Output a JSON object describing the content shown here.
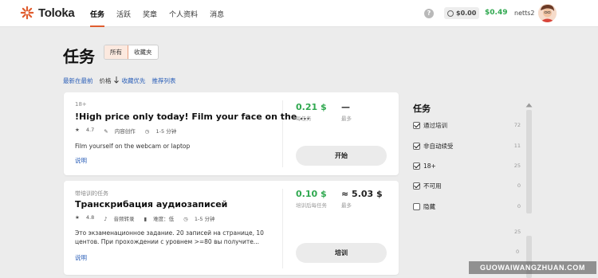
{
  "app": {
    "name": "Toloka"
  },
  "nav": {
    "items": [
      "任务",
      "活跃",
      "奖章",
      "个人资料",
      "消息"
    ]
  },
  "header": {
    "help": "?",
    "balance": "$0.00",
    "green_balance": "$0.49",
    "username": "netts2"
  },
  "page": {
    "title": "任务",
    "tabs": {
      "all": "所有",
      "favorites": "收藏夹"
    },
    "sort": {
      "newest": "最新在最前",
      "price": "价格",
      "favorites_first": "收藏优先",
      "recommended": "推荐列表"
    }
  },
  "cards": [
    {
      "eyebrow": "18+",
      "title": "!High price only today! Film your face on the ...",
      "meta": {
        "rating": "4.7",
        "tag": "内容创作",
        "time": "1-5 分钟"
      },
      "description": "Film yourself on the webcam or laptop",
      "link": "说明",
      "price": "0.21 $",
      "price_caption": "每任务",
      "max": "—",
      "max_caption": "最多",
      "button": "开始"
    },
    {
      "eyebrow": "带培训的任务",
      "title": "Транскрибация аудиозаписей",
      "meta": {
        "rating": "4.8",
        "tag": "音频转录",
        "difficulty": "难度：低",
        "time": "1-5 分钟"
      },
      "description": "Это экзаменационное задание. 20 записей на странице, 10 центов. При прохождении с уровнем >=80 вы получите...",
      "link": "说明",
      "price": "0.10 $",
      "price_caption": "培训后每任务",
      "max": "≈ 5.03 $",
      "max_caption": "最多",
      "button": "培训"
    }
  ],
  "filters": {
    "title": "任务",
    "items": [
      {
        "label": "通过培训",
        "count": "72",
        "checked": true
      },
      {
        "label": "非自动续受",
        "count": "11",
        "checked": true
      },
      {
        "label": "18+",
        "count": "25",
        "checked": true
      },
      {
        "label": "不可用",
        "count": "0",
        "checked": true
      },
      {
        "label": "隐藏",
        "count": "0",
        "checked": false
      }
    ],
    "stray_counts": [
      "25",
      "0"
    ]
  },
  "watermark": "GUOWAIWANGZHUAN.COM",
  "colors": {
    "accent": "#e05d2f",
    "green": "#2fa84f",
    "link": "#2b5fb8"
  }
}
